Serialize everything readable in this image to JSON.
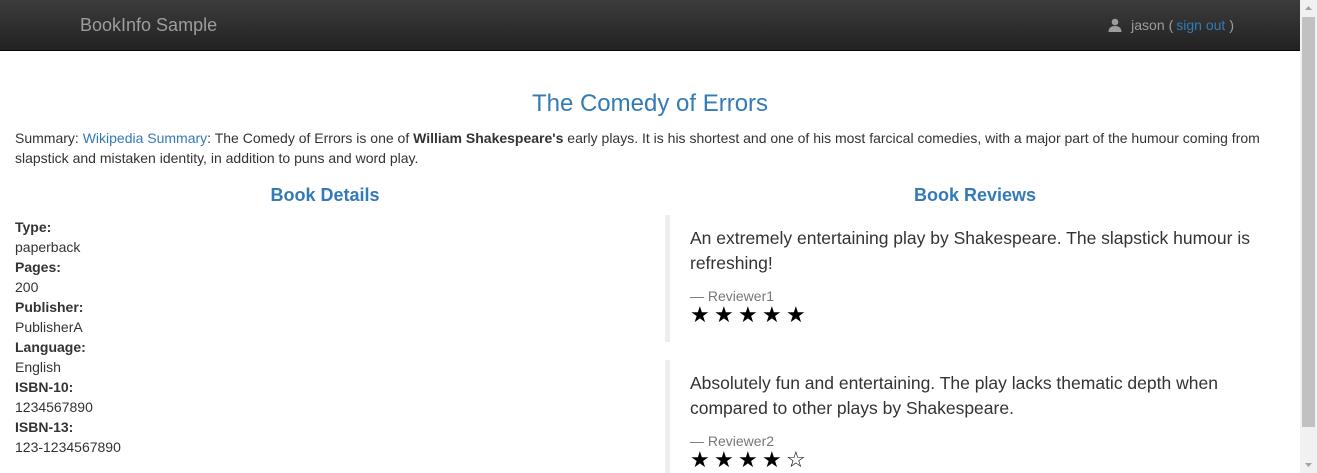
{
  "navbar": {
    "brand": "BookInfo Sample",
    "user": "jason",
    "paren_open": "(",
    "sign_out": "sign out",
    "paren_close": ")"
  },
  "book": {
    "title": "The Comedy of Errors",
    "summary_label": "Summary:",
    "summary_link": "Wikipedia Summary",
    "summary_text_1": ": The Comedy of Errors is one of ",
    "summary_bold": "William Shakespeare's",
    "summary_text_2": " early plays. It is his shortest and one of his most farcical comedies, with a major part of the humour coming from slapstick and mistaken identity, in addition to puns and word play."
  },
  "details": {
    "heading": "Book Details",
    "fields": [
      {
        "label": "Type:",
        "value": "paperback"
      },
      {
        "label": "Pages:",
        "value": "200"
      },
      {
        "label": "Publisher:",
        "value": "PublisherA"
      },
      {
        "label": "Language:",
        "value": "English"
      },
      {
        "label": "ISBN-10:",
        "value": "1234567890"
      },
      {
        "label": "ISBN-13:",
        "value": "123-1234567890"
      }
    ]
  },
  "reviews": {
    "heading": "Book Reviews",
    "items": [
      {
        "text": "An extremely entertaining play by Shakespeare. The slapstick humour is refreshing!",
        "author": "— Reviewer1",
        "rating": 5,
        "max_rating": 5
      },
      {
        "text": "Absolutely fun and entertaining. The play lacks thematic depth when compared to other plays by Shakespeare.",
        "author": "— Reviewer2",
        "rating": 4,
        "max_rating": 5
      }
    ],
    "star_color": "#000000"
  },
  "colors": {
    "link": "#337ab7",
    "navbar_bg": "#222222",
    "navbar_text": "#9d9d9d"
  }
}
